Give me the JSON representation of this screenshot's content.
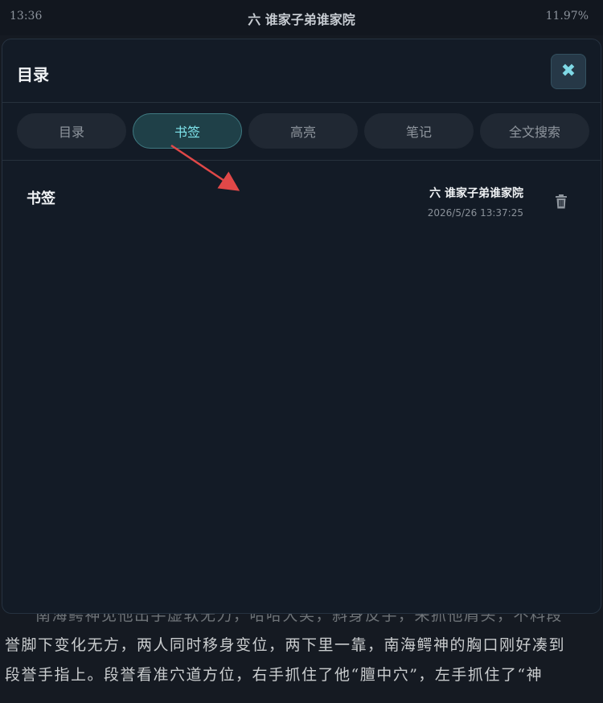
{
  "status_bar": {
    "time": "13:36",
    "chapter_title": "六 谁家子弟谁家院",
    "progress": "11.97%"
  },
  "modal": {
    "title": "目录",
    "close_icon": "close-icon",
    "tabs": [
      {
        "label": "目录",
        "active": false
      },
      {
        "label": "书签",
        "active": true
      },
      {
        "label": "高亮",
        "active": false
      },
      {
        "label": "笔记",
        "active": false
      },
      {
        "label": "全文搜索",
        "active": false
      }
    ],
    "bookmarks": [
      {
        "label": "书签",
        "chapter": "六 谁家子弟谁家院",
        "timestamp": "2026/5/26 13:37:25",
        "delete_icon": "trash-icon"
      }
    ]
  },
  "reader": {
    "lines": [
      "南海鳄神见他出手虚软无力，哈哈大笑，斜身反手，来抓他肩头，不料段",
      "誉脚下变化无方，两人同时移身变位，两下里一靠，南海鳄神的胸口刚好凑到",
      "段誉手指上。段誉看准穴道方位，右手抓住了他“膻中穴”，左手抓住了“神"
    ]
  },
  "colors": {
    "accent": "#7fe4ec",
    "annotation_arrow": "#e04848"
  }
}
